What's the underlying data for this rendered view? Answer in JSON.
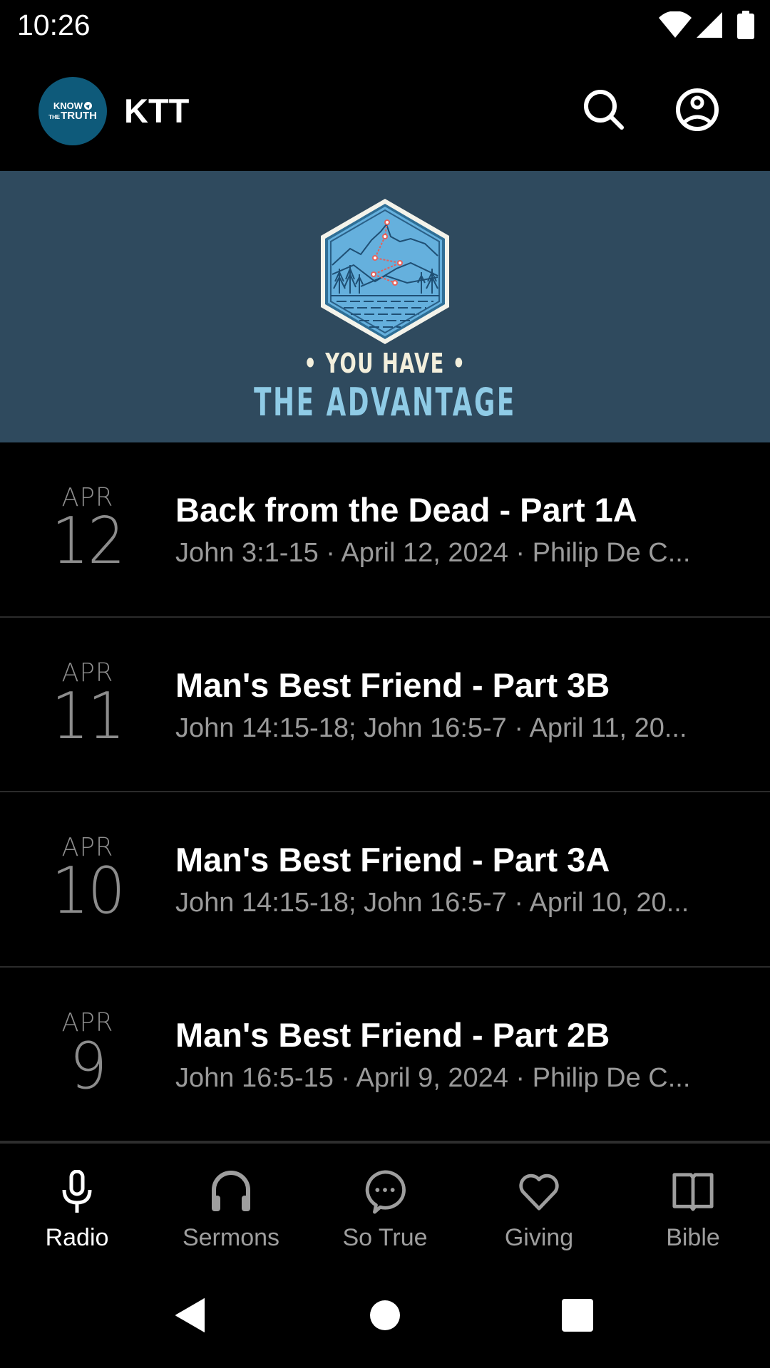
{
  "status_bar": {
    "time": "10:26",
    "icons": [
      "wifi-icon",
      "cell-signal-icon",
      "battery-icon"
    ]
  },
  "app_bar": {
    "logo": {
      "line1": "KNOW",
      "line2_small": "THE",
      "line2": "TRUTH"
    },
    "title": "KTT",
    "actions": [
      {
        "name": "search",
        "icon": "search-icon"
      },
      {
        "name": "profile",
        "icon": "account-circle-icon"
      }
    ]
  },
  "banner": {
    "line1": "• YOU HAVE •",
    "line2": "THE ADVANTAGE",
    "colors": {
      "background": "#2f4a5e",
      "line1": "#f3efdc",
      "line2": "#8fcbe6",
      "badge": "#64aedb",
      "route": "#e4615b"
    }
  },
  "episodes": [
    {
      "month": "APR",
      "day": "12",
      "title": "Back from the Dead - Part 1A",
      "subtitle": "John 3:1-15 · April 12, 2024 · Philip De C..."
    },
    {
      "month": "APR",
      "day": "11",
      "title": "Man's Best Friend - Part 3B",
      "subtitle": "John 14:15-18; John 16:5-7 · April 11, 20..."
    },
    {
      "month": "APR",
      "day": "10",
      "title": "Man's Best Friend - Part 3A",
      "subtitle": "John 14:15-18; John 16:5-7 · April 10, 20..."
    },
    {
      "month": "APR",
      "day": "9",
      "title": "Man's Best Friend - Part 2B",
      "subtitle": "John 16:5-15 · April 9, 2024 · Philip De C..."
    }
  ],
  "bottom_nav": {
    "active": "Radio",
    "tabs": [
      {
        "label": "Radio",
        "icon": "microphone-icon"
      },
      {
        "label": "Sermons",
        "icon": "headphones-icon"
      },
      {
        "label": "So True",
        "icon": "chat-bubble-icon"
      },
      {
        "label": "Giving",
        "icon": "heart-icon"
      },
      {
        "label": "Bible",
        "icon": "book-icon"
      }
    ]
  },
  "system_nav": {
    "buttons": [
      "back",
      "home",
      "recents"
    ]
  }
}
